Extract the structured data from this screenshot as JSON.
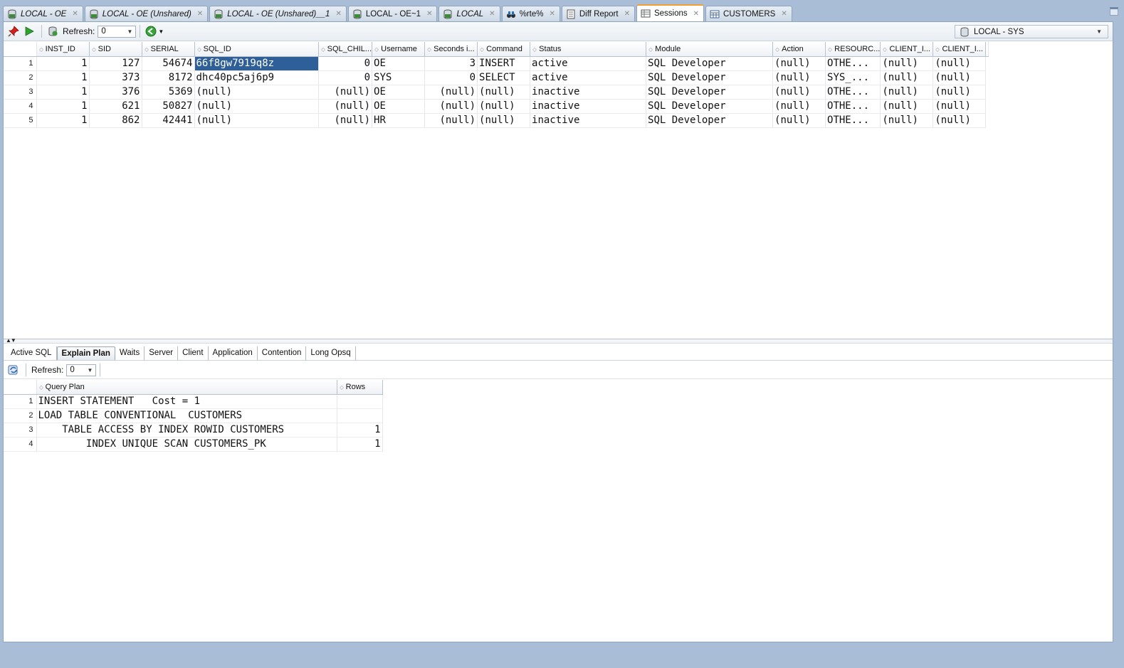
{
  "doc_tabs": [
    {
      "label": "LOCAL - OE",
      "icon": "sql-worksheet-icon",
      "italic": true,
      "closable": true
    },
    {
      "label": "LOCAL - OE (Unshared)",
      "icon": "sql-worksheet-icon",
      "italic": true,
      "closable": true
    },
    {
      "label": "LOCAL - OE (Unshared)__1",
      "icon": "sql-worksheet-icon",
      "italic": true,
      "closable": true
    },
    {
      "label": "LOCAL - OE~1",
      "icon": "sql-worksheet-icon",
      "italic": false,
      "closable": true
    },
    {
      "label": "LOCAL",
      "icon": "sql-worksheet-icon",
      "italic": true,
      "closable": true
    },
    {
      "label": "%rte%",
      "icon": "binoculars-icon",
      "italic": false,
      "closable": true
    },
    {
      "label": "Diff Report",
      "icon": "report-icon",
      "italic": false,
      "closable": true
    },
    {
      "label": "Sessions",
      "icon": "sessions-icon",
      "italic": false,
      "closable": true,
      "active": true
    },
    {
      "label": "CUSTOMERS",
      "icon": "table-icon",
      "italic": false,
      "closable": true
    }
  ],
  "toolbar": {
    "refresh_label": "Refresh:",
    "refresh_value": "0",
    "connection": "LOCAL - SYS"
  },
  "sessions": {
    "columns": [
      "INST_ID",
      "SID",
      "SERIAL",
      "SQL_ID",
      "SQL_CHIL...",
      "Username",
      "Seconds i...",
      "Command",
      "Status",
      "Module",
      "Action",
      "RESOURC...",
      "CLIENT_I...",
      "CLIENT_I..."
    ],
    "rows": [
      {
        "n": "1",
        "cells": [
          "1",
          "127",
          "54674",
          "66f8gw7919q8z",
          "0",
          "OE",
          "3",
          "INSERT",
          "active",
          "SQL Developer",
          "(null)",
          "OTHE...",
          "(null)",
          "(null)"
        ]
      },
      {
        "n": "2",
        "cells": [
          "1",
          "373",
          "8172",
          "dhc40pc5aj6p9",
          "0",
          "SYS",
          "0",
          "SELECT",
          "active",
          "SQL Developer",
          "(null)",
          "SYS_...",
          "(null)",
          "(null)"
        ]
      },
      {
        "n": "3",
        "cells": [
          "1",
          "376",
          "5369",
          "(null)",
          "(null)",
          "OE",
          "(null)",
          "(null)",
          "inactive",
          "SQL Developer",
          "(null)",
          "OTHE...",
          "(null)",
          "(null)"
        ]
      },
      {
        "n": "4",
        "cells": [
          "1",
          "621",
          "50827",
          "(null)",
          "(null)",
          "OE",
          "(null)",
          "(null)",
          "inactive",
          "SQL Developer",
          "(null)",
          "OTHE...",
          "(null)",
          "(null)"
        ]
      },
      {
        "n": "5",
        "cells": [
          "1",
          "862",
          "42441",
          "(null)",
          "(null)",
          "HR",
          "(null)",
          "(null)",
          "inactive",
          "SQL Developer",
          "(null)",
          "OTHE...",
          "(null)",
          "(null)"
        ]
      }
    ]
  },
  "detail_tabs": [
    "Active SQL",
    "Explain Plan",
    "Waits",
    "Server",
    "Client",
    "Application",
    "Contention",
    "Long Opsq"
  ],
  "detail_active_tab": "Explain Plan",
  "detail_toolbar": {
    "refresh_label": "Refresh:",
    "refresh_value": "0"
  },
  "plan": {
    "columns": [
      "Query Plan",
      "Rows"
    ],
    "rows": [
      {
        "n": "1",
        "plan": "INSERT STATEMENT   Cost = 1",
        "rows": ""
      },
      {
        "n": "2",
        "plan": "LOAD TABLE CONVENTIONAL  CUSTOMERS",
        "rows": ""
      },
      {
        "n": "3",
        "plan": "    TABLE ACCESS BY INDEX ROWID CUSTOMERS",
        "rows": "1"
      },
      {
        "n": "4",
        "plan": "        INDEX UNIQUE SCAN CUSTOMERS_PK",
        "rows": "1"
      }
    ]
  },
  "colors": {
    "background": "#a9bdd6",
    "selection": "#2e5f98",
    "active_tab_accent": "#f0a030"
  }
}
